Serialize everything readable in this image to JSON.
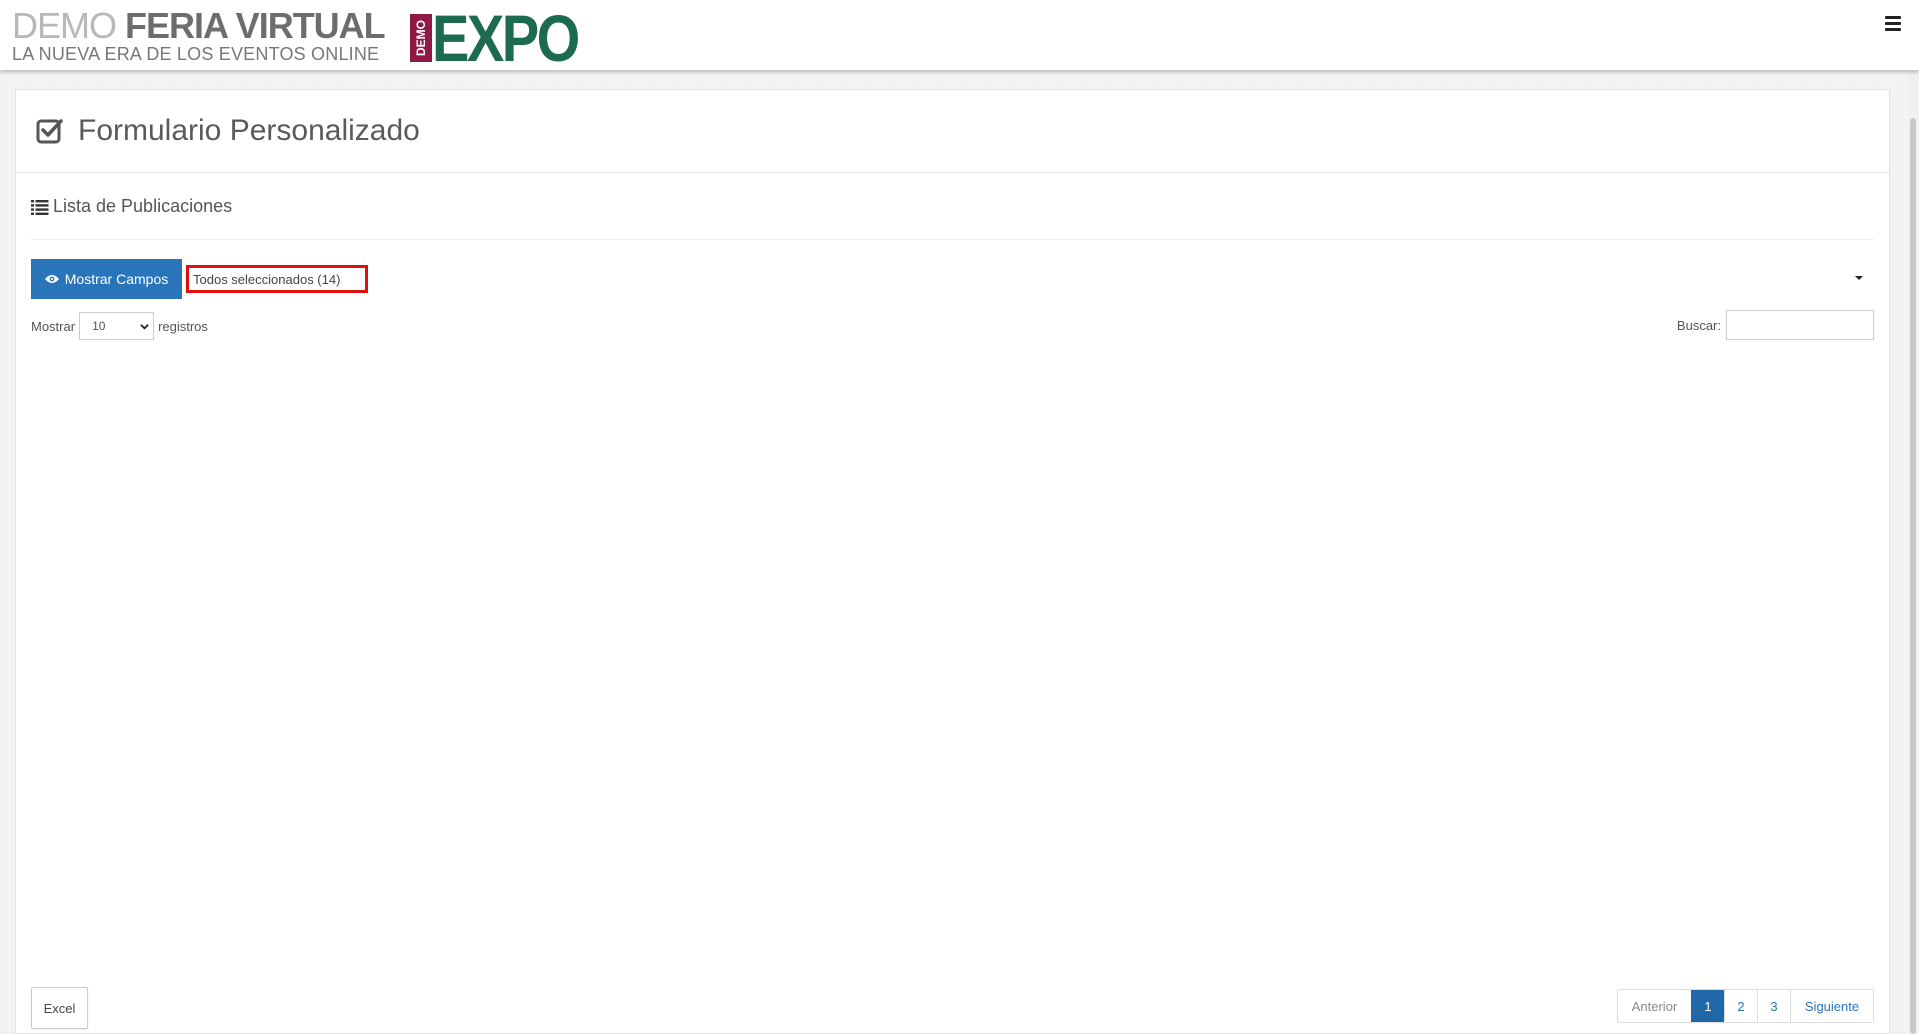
{
  "header": {
    "brand_demo": "DEMO",
    "brand_feria": "FERIA VIRTUAL",
    "tagline": "LA NUEVA ERA DE LOS EVENTOS ONLINE",
    "logo_small": "DEMO",
    "logo_big": "EXPO",
    "menu_icon": "hamburger-menu-icon"
  },
  "page": {
    "title": "Formulario Personalizado",
    "title_icon": "checkbox-icon",
    "section_title": "Lista de Publicaciones",
    "section_icon": "list-icon"
  },
  "toolbar": {
    "show_fields_label": "Mostrar Campos",
    "show_fields_icon": "eye-icon",
    "multiselect_value": "Todos seleccionados (14)"
  },
  "table_controls": {
    "show_label": "Mostrar",
    "length_value": "10",
    "records_label": "registros",
    "search_label": "Buscar:",
    "search_value": ""
  },
  "footer": {
    "excel_label": "Excel",
    "pagination": {
      "prev": "Anterior",
      "pages": [
        "1",
        "2",
        "3"
      ],
      "active_page": "1",
      "next": "Siguiente"
    }
  },
  "colors": {
    "primary": "#2a74b9",
    "logo_green": "#1c6b4e",
    "logo_maroon": "#8f1a44",
    "highlight": "#e01010"
  }
}
